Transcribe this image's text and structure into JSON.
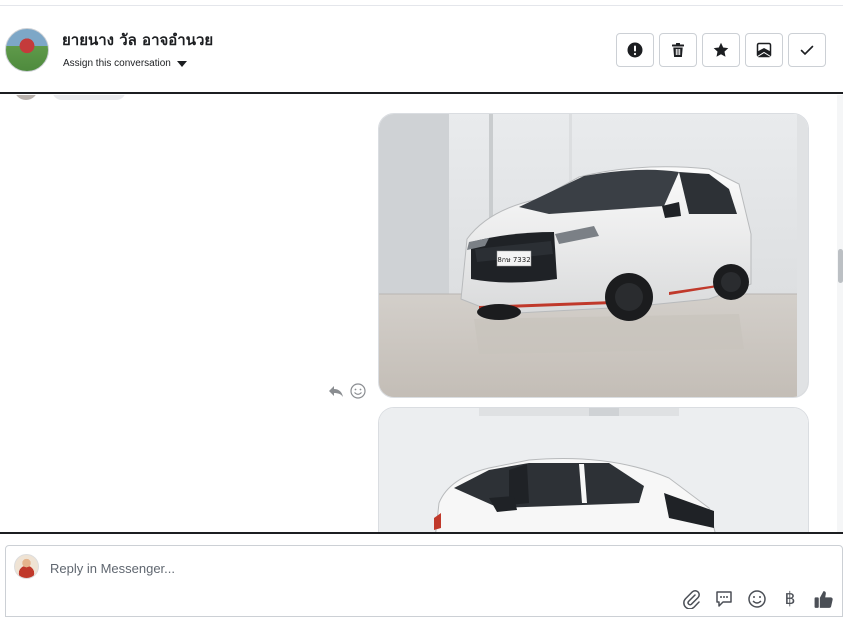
{
  "header": {
    "contact_name": "ยายนาง วัล อาจอำนวย",
    "assign_label": "Assign this conversation",
    "actions": [
      {
        "name": "mark-spam-button",
        "icon": "exclamation-icon"
      },
      {
        "name": "delete-button",
        "icon": "trash-icon"
      },
      {
        "name": "star-button",
        "icon": "star-icon"
      },
      {
        "name": "mark-unread-button",
        "icon": "envelope-icon"
      },
      {
        "name": "mark-done-button",
        "icon": "checkmark-icon"
      }
    ]
  },
  "conversation": {
    "messages": [
      {
        "type": "image",
        "subject": "white minivan in showroom, front three-quarter view",
        "plate": "8กษ 7332"
      },
      {
        "type": "image",
        "subject": "white minivan in showroom, side view (partially visible)"
      }
    ],
    "message_tools": [
      "reply-icon",
      "smiley-icon"
    ]
  },
  "composer": {
    "placeholder": "Reply in Messenger...",
    "tools": [
      "paperclip-icon",
      "saved-reply-icon",
      "emoji-icon",
      "baht-currency-icon",
      "thumbs-up-icon"
    ],
    "currency_symbol": "฿"
  }
}
